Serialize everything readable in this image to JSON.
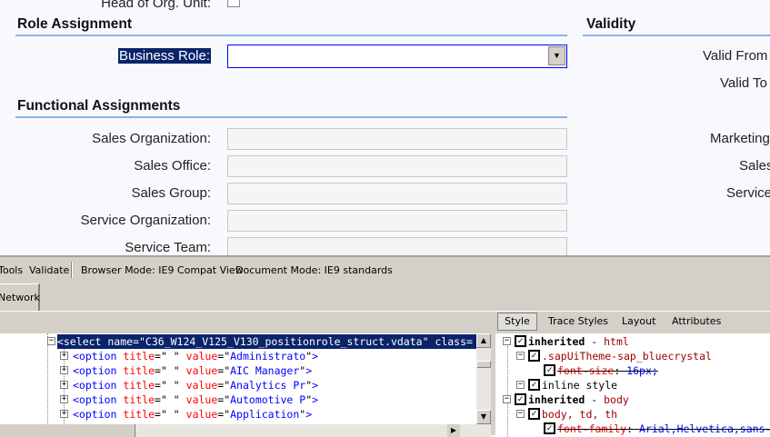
{
  "form": {
    "head_org_unit_label": "Head of Org. Unit:",
    "role_assignment": {
      "title": "Role Assignment",
      "business_role_label": "Business Role:",
      "business_role_value": ""
    },
    "functional_assignments": {
      "title": "Functional Assignments",
      "fields": [
        {
          "label": "Sales Organization:",
          "value": ""
        },
        {
          "label": "Sales Office:",
          "value": ""
        },
        {
          "label": "Sales Group:",
          "value": ""
        },
        {
          "label": "Service Organization:",
          "value": ""
        },
        {
          "label": "Service Team:",
          "value": ""
        }
      ]
    },
    "validity": {
      "title": "Validity",
      "labels": [
        "Valid From",
        "Valid To"
      ]
    },
    "right_labels": [
      "Marketing",
      "Sales",
      "Service"
    ]
  },
  "devtools": {
    "menu": [
      "Tools",
      "Validate"
    ],
    "browser_mode": "Browser Mode:  IE9 Compat View",
    "document_mode": "Document Mode:  IE9 standards",
    "tab": "Network",
    "right_tabs": [
      "Style",
      "Trace Styles",
      "Layout",
      "Attributes"
    ],
    "tree": {
      "selected": "<select name=\"C36_W124_V125_V130_positionrole_struct.vdata\" class=",
      "options": [
        "Administrato",
        "AIC Manager",
        "Analytics Pr",
        "Automotive P",
        "Application"
      ]
    },
    "styles": [
      {
        "kind": "inherited",
        "text": "inherited",
        "suffix": " - ",
        "target": "html"
      },
      {
        "kind": "rule",
        "text": ".sapUiTheme-sap_bluecrystal"
      },
      {
        "kind": "prop",
        "name": "font-size",
        "value": " 16px;"
      },
      {
        "kind": "plain",
        "text": "inline style"
      },
      {
        "kind": "inherited",
        "text": "inherited",
        "suffix": " - ",
        "target": "body"
      },
      {
        "kind": "rule",
        "text": "body, td, th"
      },
      {
        "kind": "prop",
        "name": "font-family",
        "value": " Arial,Helvetica,sans-"
      }
    ]
  }
}
